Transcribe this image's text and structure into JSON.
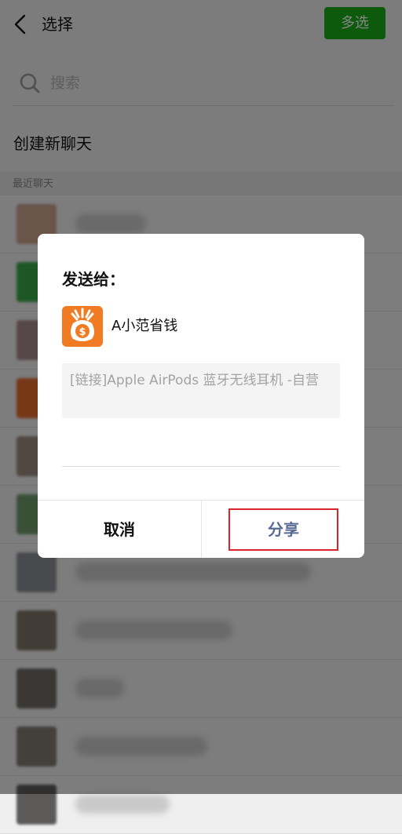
{
  "header": {
    "title": "选择",
    "multi_select_label": "多选"
  },
  "search": {
    "placeholder": "搜索"
  },
  "new_chat_label": "创建新聊天",
  "recent_section_label": "最近聊天",
  "chat_list": [
    {
      "avatar_color": "#c9a38e",
      "name_width": 90
    },
    {
      "avatar_color": "#3aa84a",
      "name_width": 0
    },
    {
      "avatar_color": "#a68a8a",
      "name_width": 0
    },
    {
      "avatar_color": "#e26b2c",
      "name_width": 0
    },
    {
      "avatar_color": "#9a8b7d",
      "name_width": 0
    },
    {
      "avatar_color": "#6e9a6a",
      "name_width": 0
    },
    {
      "avatar_color": "#8a8f96",
      "name_width": 300
    },
    {
      "avatar_color": "#7d7466",
      "name_width": 200
    },
    {
      "avatar_color": "#6f6a64",
      "name_width": 62
    },
    {
      "avatar_color": "#807a72",
      "name_width": 168
    },
    {
      "avatar_color": "#5c5a58",
      "name_width": 120
    }
  ],
  "dialog": {
    "title": "发送给：",
    "recipient_name": "A小范省钱",
    "recipient_icon": "money-bag-icon",
    "message_preview": "[链接]Apple  AirPods 蓝牙无线耳机 -自营",
    "message_input_value": "",
    "cancel_label": "取消",
    "share_label": "分享"
  },
  "colors": {
    "accent_green": "#1aad19",
    "share_text": "#576b95",
    "highlight_border": "#d9232d",
    "app_icon_orange": "#f07b22"
  }
}
